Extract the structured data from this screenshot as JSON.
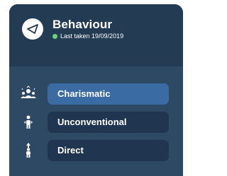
{
  "card": {
    "title": "Behaviour",
    "subtitle": "Last taken 19/09/2019",
    "header_icon": "triangle-compass-icon",
    "status_color": "#6ed17c"
  },
  "traits": [
    {
      "label": "Charismatic",
      "icon": "people-group-icon",
      "selected": true
    },
    {
      "label": "Unconventional",
      "icon": "person-arrows-icon",
      "selected": false
    },
    {
      "label": "Direct",
      "icon": "person-up-arrow-icon",
      "selected": false
    }
  ],
  "colors": {
    "card_background": "#2e4964",
    "header_background": "#233b53",
    "pill_background": "#1f3550",
    "pill_selected": "#3a6ba3",
    "text": "#ffffff"
  }
}
